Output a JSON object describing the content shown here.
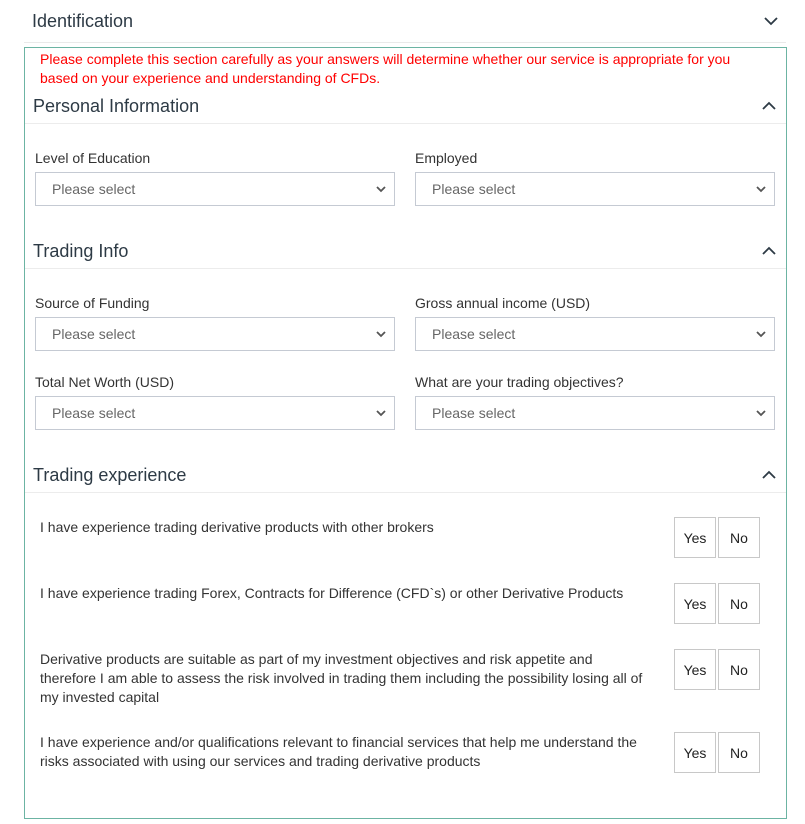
{
  "identification": {
    "title": "Identification",
    "chevron_icon": "chevron-down-icon"
  },
  "warning_text": "Please complete this section carefully as your answers will determine whether our service is appropriate for you based on your experience and understanding of CFDs.",
  "colors": {
    "warning": "#ff0000",
    "panel_border": "#6cb4a3",
    "heading": "#2d3a45"
  },
  "personal_information": {
    "title": "Personal Information",
    "chevron_icon": "chevron-up-icon",
    "fields": [
      {
        "label": "Level of Education",
        "placeholder": "Please select"
      },
      {
        "label": "Employed",
        "placeholder": "Please select"
      }
    ]
  },
  "trading_info": {
    "title": "Trading Info",
    "chevron_icon": "chevron-up-icon",
    "fields": [
      {
        "label": "Source of Funding",
        "placeholder": "Please select"
      },
      {
        "label": "Gross annual income (USD)",
        "placeholder": "Please select"
      },
      {
        "label": "Total Net Worth (USD)",
        "placeholder": "Please select"
      },
      {
        "label": "What are your trading objectives?",
        "placeholder": "Please select"
      }
    ]
  },
  "trading_experience": {
    "title": "Trading experience",
    "chevron_icon": "chevron-up-icon",
    "yes_label": "Yes",
    "no_label": "No",
    "questions": [
      {
        "text": "I have experience trading derivative products with other brokers"
      },
      {
        "text": "I have experience trading Forex, Contracts for Difference (CFD`s) or other Derivative Products"
      },
      {
        "text": "Derivative products are suitable as part of my investment objectives and risk appetite and therefore I am able to assess the risk involved in trading them including the possibility losing all of my invested capital"
      },
      {
        "text": "I have experience and/or qualifications relevant to financial services that help me understand the risks associated with using our services and trading derivative products"
      }
    ]
  }
}
